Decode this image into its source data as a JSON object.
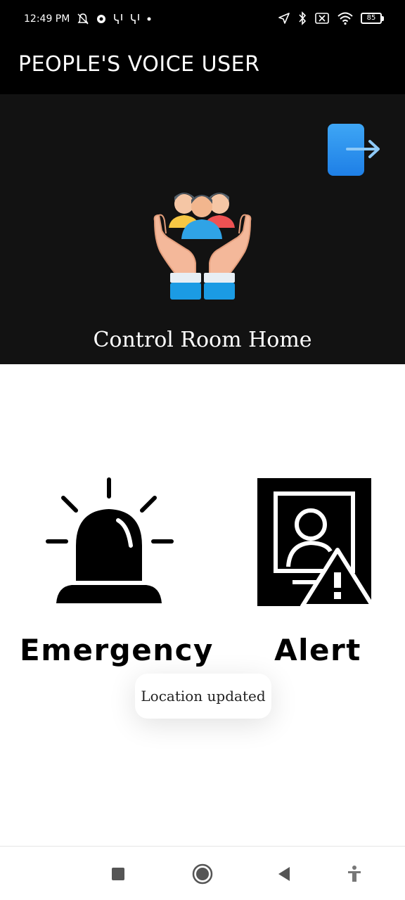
{
  "status_bar": {
    "time": "12:49 PM",
    "battery_level": "85",
    "icons_left": [
      "bell-off-icon",
      "app-icon",
      "y-app-icon",
      "y-app-icon",
      "dot-icon"
    ],
    "icons_right": [
      "location-arrow-icon",
      "bluetooth-icon",
      "sim-off-icon",
      "wifi-icon",
      "battery-icon"
    ]
  },
  "app_bar": {
    "title": "PEOPLE'S VOICE USER"
  },
  "header": {
    "logout_icon": "logout-icon",
    "hero_icon": "people-in-hands-icon",
    "title": "Control Room Home"
  },
  "actions": {
    "emergency": {
      "label": "Emergency",
      "icon": "siren-icon"
    },
    "alert": {
      "label": "Alert",
      "icon": "person-warning-icon"
    }
  },
  "toast": {
    "message": "Location updated"
  },
  "nav_bar": {
    "buttons": [
      "recents-square-icon",
      "home-circle-icon",
      "back-triangle-icon",
      "accessibility-icon"
    ]
  },
  "colors": {
    "app_bar_bg": "#000000",
    "header_bg": "#121212",
    "logout_blue": "#2196F3",
    "page_bg": "#FFFFFF"
  }
}
